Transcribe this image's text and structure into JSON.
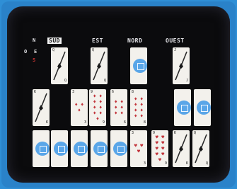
{
  "players": {
    "sud": "SUD",
    "est": "EST",
    "nord": "NORD",
    "ouest": "OUEST"
  },
  "legend": {
    "n": "N",
    "o": "O",
    "e": "E",
    "s": "S"
  },
  "colors": {
    "bezel": "#2a82c9",
    "screen": "#0b0b0d",
    "card": "#f3f1ec",
    "disc": "#5aa6e8",
    "red_suit": "#c2343b"
  },
  "trick": [
    {
      "seat": "sud",
      "corner": "Q",
      "suit": "spades",
      "face": "diagonal"
    },
    {
      "seat": "est",
      "corner": "Q",
      "suit": "spades",
      "face": "diagonal"
    },
    {
      "seat": "nord",
      "corner": "",
      "suit": "",
      "face": "disc"
    },
    {
      "seat": "ouest",
      "corner": "J",
      "suit": "spades",
      "face": "diagonal"
    }
  ],
  "dummy": [
    {
      "corner": "K",
      "suit": "clubs",
      "face": "diagonal"
    },
    {
      "corner": "3",
      "suit": "diamonds",
      "face": "pips",
      "count": 3
    },
    {
      "corner": "9",
      "suit": "diamonds",
      "face": "pips",
      "count": 9
    },
    {
      "corner": "6",
      "suit": "diamonds",
      "face": "pips",
      "count": 6
    },
    {
      "corner": "8",
      "suit": "diamonds",
      "face": "pips",
      "count": 8
    },
    {
      "corner": "",
      "suit": "",
      "face": "disc"
    },
    {
      "corner": "",
      "suit": "",
      "face": "disc"
    }
  ],
  "hand": [
    {
      "corner": "",
      "face": "disc"
    },
    {
      "corner": "",
      "face": "disc"
    },
    {
      "corner": "",
      "face": "disc"
    },
    {
      "corner": "",
      "face": "disc"
    },
    {
      "corner": "",
      "face": "disc"
    },
    {
      "corner": "3",
      "suit": "hearts",
      "face": "pips",
      "count": 3
    },
    {
      "corner": "9",
      "suit": "hearts",
      "face": "pips",
      "count": 9
    },
    {
      "corner": "K",
      "suit": "clubs",
      "face": "diagonal"
    },
    {
      "corner": "Q",
      "suit": "clubs",
      "face": "diagonal"
    }
  ]
}
